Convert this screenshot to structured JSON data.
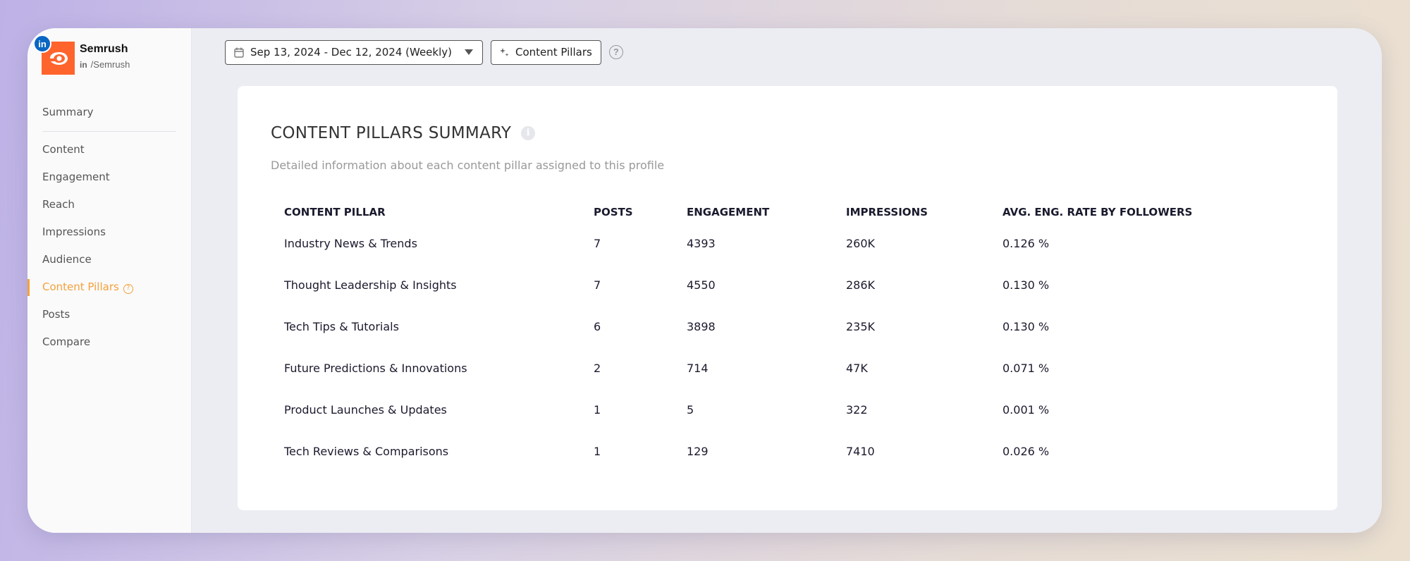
{
  "profile": {
    "name": "Semrush",
    "handle": "/Semrush",
    "network_badge": "in",
    "handle_network": "in",
    "brand_color": "#ff642d",
    "linkedin_color": "#0a66c2"
  },
  "sidebar": {
    "items": [
      {
        "label": "Summary"
      },
      {
        "label": "Content"
      },
      {
        "label": "Engagement"
      },
      {
        "label": "Reach"
      },
      {
        "label": "Impressions"
      },
      {
        "label": "Audience"
      },
      {
        "label": "Content Pillars",
        "active": true
      },
      {
        "label": "Posts"
      },
      {
        "label": "Compare"
      }
    ],
    "active_color": "#f5a13a"
  },
  "toolbar": {
    "date_range": "Sep 13, 2024 - Dec 12, 2024 (Weekly)",
    "pillars_button": "Content Pillars",
    "help": "?"
  },
  "summary": {
    "title": "CONTENT PILLARS SUMMARY",
    "subtitle": "Detailed information about each content pillar assigned to this profile",
    "columns": [
      "CONTENT PILLAR",
      "POSTS",
      "ENGAGEMENT",
      "IMPRESSIONS",
      "AVG. ENG. RATE BY FOLLOWERS"
    ],
    "rows": [
      [
        "Industry News & Trends",
        "7",
        "4393",
        "260K",
        "0.126 %"
      ],
      [
        "Thought Leadership & Insights",
        "7",
        "4550",
        "286K",
        "0.130 %"
      ],
      [
        "Tech Tips & Tutorials",
        "6",
        "3898",
        "235K",
        "0.130 %"
      ],
      [
        "Future Predictions & Innovations",
        "2",
        "714",
        "47K",
        "0.071 %"
      ],
      [
        "Product Launches & Updates",
        "1",
        "5",
        "322",
        "0.001 %"
      ],
      [
        "Tech Reviews & Comparisons",
        "1",
        "129",
        "7410",
        "0.026 %"
      ]
    ]
  }
}
